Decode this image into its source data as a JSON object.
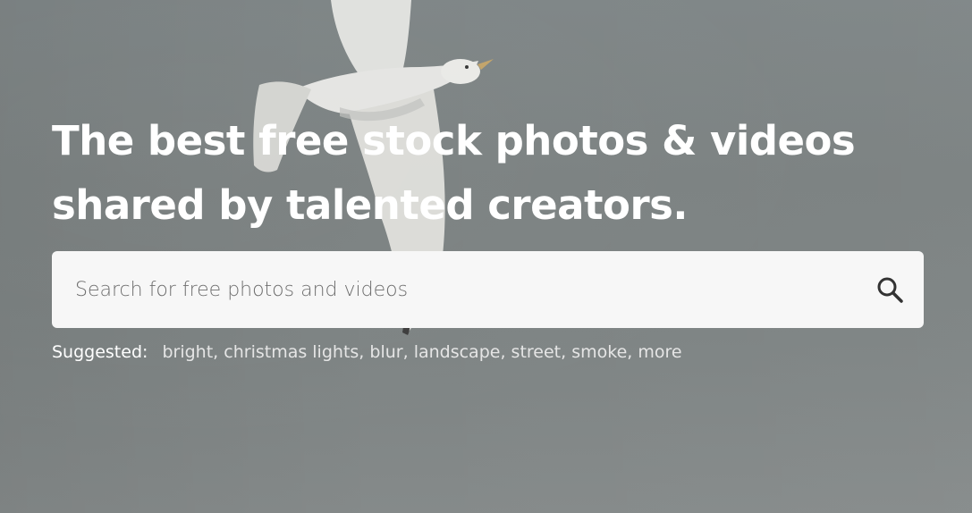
{
  "hero": {
    "headline_line1": "The best free stock photos & videos",
    "headline_line2": "shared by talented creators.",
    "background_color": "#7e8586"
  },
  "search": {
    "placeholder": "Search for free photos and videos",
    "value": "",
    "icon": "search-icon"
  },
  "suggested": {
    "label": "Suggested:",
    "items": [
      "bright",
      "christmas lights",
      "blur",
      "landscape",
      "street",
      "smoke",
      "more"
    ]
  }
}
